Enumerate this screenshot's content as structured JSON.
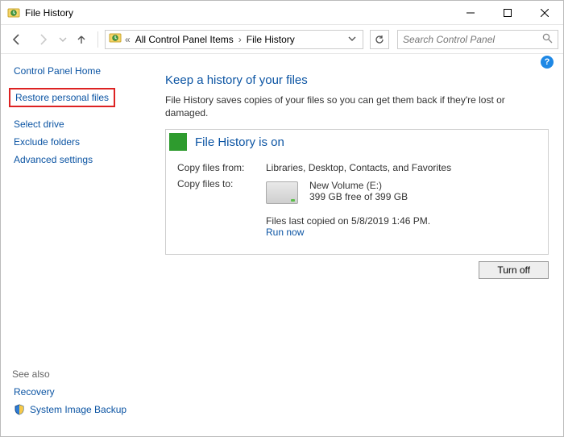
{
  "window": {
    "title": "File History"
  },
  "nav": {
    "breadcrumb": {
      "seg1": "All Control Panel Items",
      "seg2": "File History"
    },
    "search_placeholder": "Search Control Panel"
  },
  "sidebar": {
    "home": "Control Panel Home",
    "restore": "Restore personal files",
    "select_drive": "Select drive",
    "exclude": "Exclude folders",
    "advanced": "Advanced settings",
    "see_also_label": "See also",
    "recovery": "Recovery",
    "system_image": "System Image Backup"
  },
  "main": {
    "heading": "Keep a history of your files",
    "subtext": "File History saves copies of your files so you can get them back if they're lost or damaged.",
    "status_title": "File History is on",
    "copy_from_label": "Copy files from:",
    "copy_from_value": "Libraries, Desktop, Contacts, and Favorites",
    "copy_to_label": "Copy files to:",
    "drive_name": "New Volume (E:)",
    "drive_space": "399 GB free of 399 GB",
    "last_copied": "Files last copied on 5/8/2019 1:46 PM.",
    "run_now": "Run now",
    "turn_off": "Turn off"
  }
}
